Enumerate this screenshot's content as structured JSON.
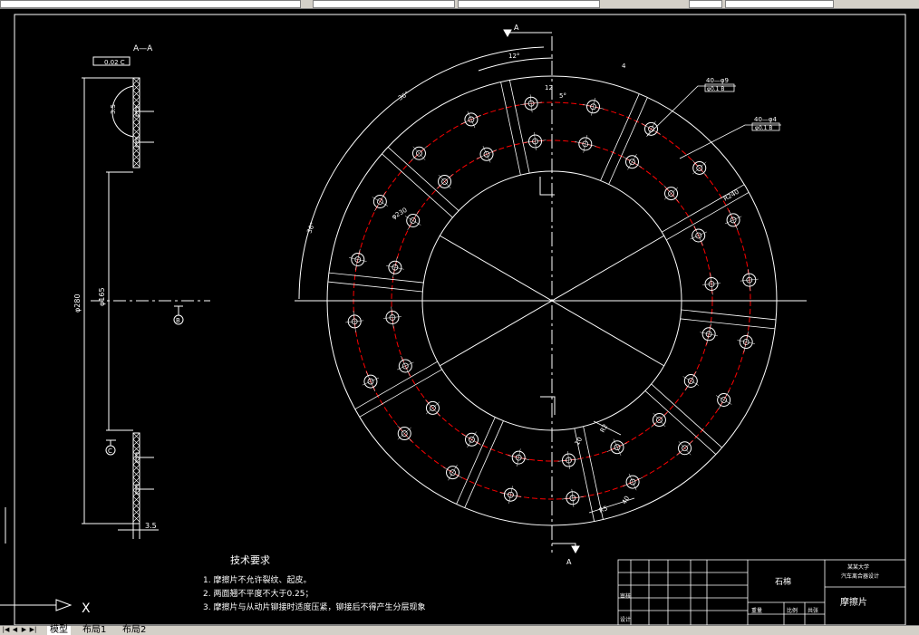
{
  "colors": {
    "background": "#000000",
    "lines": "#ffffff",
    "center_lines": "#ff0000",
    "ui_bar": "#d4d0c8"
  },
  "section_view": {
    "title": "A—A",
    "flatness_callout": "0.02 C",
    "dim_small": "3.5",
    "dim_overall": "φ280",
    "dim_inner": "φ165",
    "dim_thickness": "3.5",
    "datum_b": "B",
    "datum_c": "C"
  },
  "main_view": {
    "section_mark_top": "A",
    "section_mark_bottom": "A",
    "angle_12": "12°",
    "angle_36": "36°",
    "angle_5": "5°",
    "dim_12_top": "12",
    "dim_4": "4",
    "hole_callout_1": "40—φ9",
    "hole_callout_1_tol": "φ0.1 B",
    "hole_callout_2": "40—φ4",
    "hole_callout_2_tol": "φ0.1 B",
    "dim_r230": "R230",
    "dim_r240": "R240",
    "dim_r_left": "φ230",
    "dim_r2": "R2",
    "dim_10": "10",
    "dim_5": "R5",
    "dim_40": "40"
  },
  "tech_requirements": {
    "title": "技术要求",
    "items": [
      "1. 摩擦片不允许裂纹、起皮。",
      "2. 两面翘不平度不大于0.25；",
      "3. 摩擦片与从动片铆接时适度压紧，铆接后不得产生分层现象"
    ]
  },
  "title_block": {
    "material": "石棉",
    "company_line1": "某某大学",
    "company_line2": "汽车离合器设计",
    "part_name": "摩擦片",
    "label_designer": "设计",
    "label_check": "审核",
    "label_scale": "比例",
    "label_weight": "重量",
    "label_sheet": "共张"
  },
  "ucs": {
    "x_label": "X"
  },
  "tabs": [
    "模型",
    "布局1",
    "布局2"
  ]
}
